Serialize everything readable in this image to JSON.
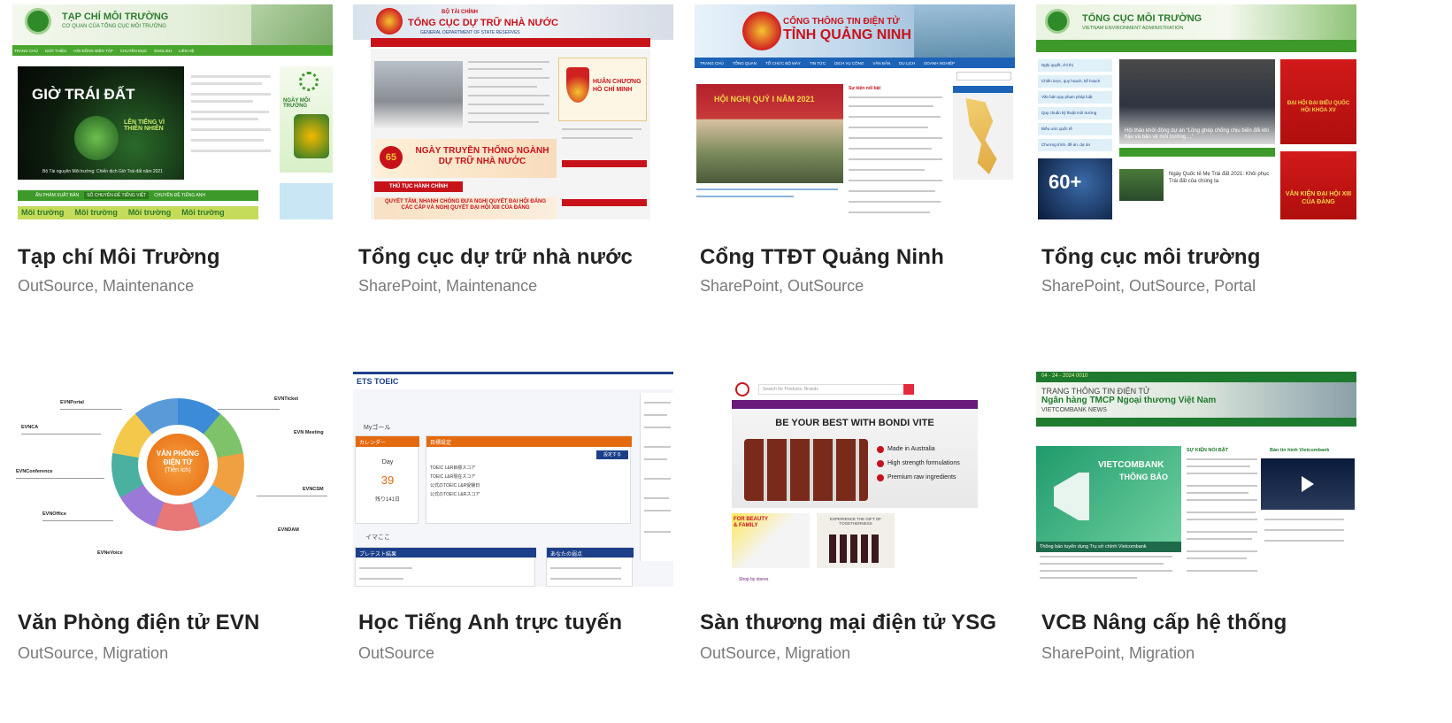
{
  "cards": [
    {
      "title": "Tạp chí Môi Trường",
      "tags": "OutSource, Maintenance",
      "shot": {
        "header_line1": "TẠP CHÍ MÔI TRƯỜNG",
        "header_line2": "CƠ QUAN CỦA TỔNG CỤC MÔI TRƯỜNG",
        "nav": [
          "TRANG CHỦ",
          "GIỚI THIỆU",
          "HỘI ĐỒNG BIÊN TẬP",
          "CHUYÊN MỤC",
          "ENGLISH",
          "LIÊN HỆ"
        ],
        "hero_title": "GIỜ TRÁI ĐẤT",
        "hero_sub": "LÊN TIẾNG VÌ THIÊN NHIÊN",
        "hero_caption": "Bộ Tài nguyên Môi trường: Chiến dịch Giờ Trái đất năm 2021",
        "side_caption": "NGÀY MÔI TRƯỜNG",
        "tab1": "ẤN PHẨM XUẤT BẢN",
        "tab2": "SỐ CHUYÊN ĐỀ TIẾNG VIỆT",
        "tab3": "CHUYÊN ĐỀ TIẾNG ANH",
        "footer_tag": "Môi trường"
      }
    },
    {
      "title": "Tổng cục dự trữ nhà nước",
      "tags": "SharePoint, Maintenance",
      "shot": {
        "ministry": "BỘ TÀI CHÍNH",
        "org": "TỔNG CỤC DỰ TRỮ NHÀ NƯỚC",
        "org_en": "GENERAL DEPARTMENT OF STATE RESERVES",
        "medal": "HUÂN CHƯƠNG HỒ CHÍ MINH",
        "banner": "NGÀY TRUYỀN THỐNG NGÀNH DỰ TRỮ NHÀ NƯỚC",
        "badge": "65",
        "btn": "THỦ TỤC HÀNH CHÍNH",
        "slogan": "QUYẾT TÂM, NHANH CHÓNG ĐƯA NGHỊ QUYẾT ĐẠI HỘI ĐẢNG CÁC CẤP VÀ NGHỊ QUYẾT ĐẠI HỘI XIII CỦA ĐẢNG"
      }
    },
    {
      "title": "Cổng TTĐT Quảng Ninh",
      "tags": "SharePoint, OutSource",
      "shot": {
        "line1": "CỔNG THÔNG TIN ĐIỆN TỬ",
        "line2": "TỈNH QUẢNG NINH",
        "nav": [
          "TRANG CHỦ",
          "TỔNG QUAN",
          "TỔ CHỨC BỘ MÁY",
          "TIN TỨC",
          "DỊCH VỤ CÔNG",
          "VĂN BẢN",
          "DU LỊCH",
          "DOANH NGHIỆP"
        ],
        "banner": "HỘI NGHỊ QUÝ I NĂM 2021",
        "tab": "Sự kiện nổi bật"
      }
    },
    {
      "title": "Tổng cục môi trường",
      "tags": "SharePoint, OutSource, Portal",
      "shot": {
        "line1": "TỔNG CỤC MÔI TRƯỜNG",
        "line2": "VIETNAM ENVIRONMENT ADMINISTRATION",
        "menu": [
          "Nghị quyết, chỉ thị",
          "Chiến lược, quy hoạch, kế hoạch",
          "Văn bản quy phạm pháp luật",
          "Quy chuẩn kỹ thuật môi trường",
          "Điều ước quốc tế",
          "Chương trình, đề án, dự án"
        ],
        "news": "Hội thảo khởi động dự án “Lồng ghép chống chịu biến đổi khí hậu và bảo vệ môi trường ...”",
        "item": "Ngày Quốc tế Mẹ Trái đất 2021: Khôi phục Trái đất của chúng ta",
        "poster1": "ĐẠI HỘI ĐẠI BIỂU QUỐC HỘI KHÓA XV",
        "poster2": "VĂN KIỆN ĐẠI HỘI XIII CỦA ĐẢNG",
        "earth": "60+"
      }
    },
    {
      "title": "Văn Phòng điện tử EVN",
      "tags": "OutSource, Migration",
      "shot": {
        "center1": "VĂN PHÒNG",
        "center2": "ĐIỆN TỬ",
        "center3": "(Tiện ích)",
        "labels": [
          "EVNPortal",
          "EVNTicket",
          "EVNCA",
          "EVN Meeting",
          "EVNConference",
          "EVNCSM",
          "EVNOffice",
          "EVNDAM",
          "EVNeVoice"
        ]
      }
    },
    {
      "title": "Học Tiếng Anh trực tuyến",
      "tags": "OutSource",
      "shot": {
        "logo": "ETS TOEIC",
        "calendar_head": "カレンダー",
        "day_label": "Day",
        "day_value": "39",
        "remain": "残り141日",
        "goal_head": "目標設定",
        "goal_btn": "設定する",
        "score_rows": [
          "TOEIC L&R目標スコア",
          "TOEIC L&R現在スコア",
          "公式のTOEIC L&R受験日",
          "公式のTOEIC L&Rスコア"
        ],
        "section2": "イマここ",
        "test_head": "プレテスト結果",
        "weak_head": "あなたの弱点",
        "myg": "Myゴール"
      }
    },
    {
      "title": "Sàn thương mại điện tử YSG",
      "tags": "OutSource, Migration",
      "shot": {
        "search": "Search for Products, Brands",
        "hero": "BE YOUR BEST WITH BONDI VITE",
        "b1": "Made in Australia",
        "b2": "High strength formulations",
        "b3": "Premium raw ingredients",
        "promo": "EXPERIENCE THE GIFT OF TOGETHERNESS",
        "sale": "FOR BEAUTY & FAMILY",
        "shop": "Shop by stores"
      }
    },
    {
      "title": "VCB Nâng cấp hệ thống",
      "tags": "SharePoint, Migration",
      "shot": {
        "top": "04 - 24 - 2024 0010",
        "line1": "TRANG THÔNG TIN ĐIỆN TỬ",
        "line2": "Ngân hàng TMCP Ngoại thương Việt Nam",
        "line3": "VIETCOMBANK NEWS",
        "brand": "VIETCOMBANK",
        "notice": "THÔNG BÁO",
        "caption": "Thông báo tuyển dụng Trụ sở chính Vietcombank",
        "col2_head": "SỰ KIỆN NỔI BẬT",
        "col3_head": "Bản tin hình Vietcombank"
      }
    }
  ],
  "colors": {
    "title": "#222222",
    "tags": "#7a7a7a",
    "green": "#3d9a2a",
    "red": "#c8121a",
    "navy": "#1c3f8a"
  }
}
